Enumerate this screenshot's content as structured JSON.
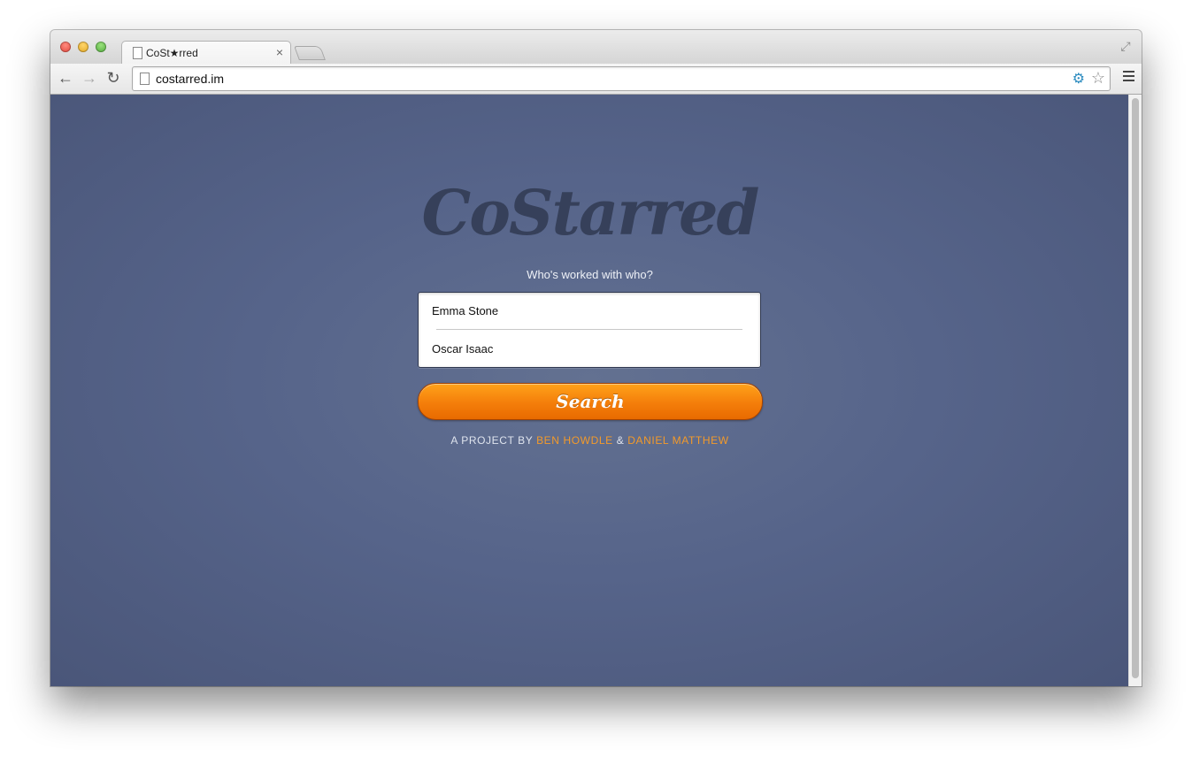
{
  "browser": {
    "tab_title": "CoSt★rred",
    "url": "costarred.im"
  },
  "page": {
    "logo_text": "CoStarred",
    "tagline": "Who's worked with who?",
    "actor_1": "Emma Stone",
    "actor_2": "Oscar Isaac",
    "search_label": "Search",
    "credits_prefix": "A PROJECT BY",
    "credit_1": "BEN HOWDLE",
    "credits_sep": "&",
    "credit_2": "DANIEL MATTHEW"
  },
  "colors": {
    "background": "#56648a",
    "button": "#f47e0a",
    "logo": "#36405a",
    "link": "#f39a2a"
  },
  "icons": {
    "back": "arrow-left-icon",
    "forward": "arrow-right-icon",
    "reload": "reload-icon",
    "bookmark": "star-icon",
    "menu": "hamburger-menu-icon"
  }
}
